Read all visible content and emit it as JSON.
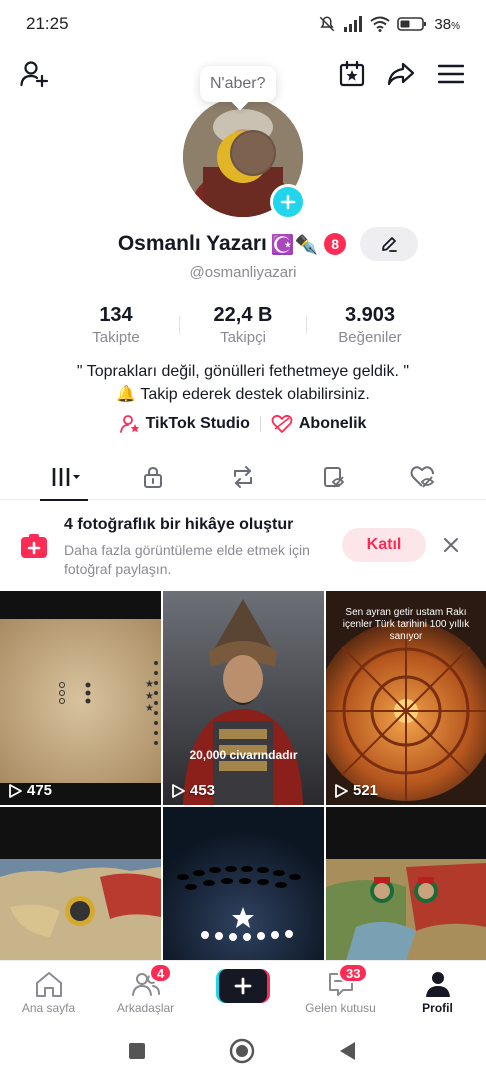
{
  "status_bar": {
    "time": "21:25",
    "battery": "38",
    "battery_unit": "%"
  },
  "bubble": {
    "text": "N'aber?"
  },
  "profile": {
    "name": "Osmanlı Yazarı",
    "name_emoji": "☪️✒️",
    "notification_count": "8",
    "username": "@osmanliyazari"
  },
  "stats": [
    {
      "value": "134",
      "label": "Takipte"
    },
    {
      "value": "22,4 B",
      "label": "Takipçi"
    },
    {
      "value": "3.903",
      "label": "Beğeniler"
    }
  ],
  "bio": {
    "line1": "\" Toprakları değil, gönülleri fethetmeye geldik. \"",
    "line2": "🔔 Takip ederek destek olabilirsiniz."
  },
  "links": {
    "studio": "TikTok Studio",
    "subscription": "Abonelik"
  },
  "story": {
    "title": "4 fotoğraflık bir hikâye oluştur",
    "subtitle": "Daha fazla görüntüleme elde etmek için fotoğraf paylaşın.",
    "join_label": "Katıl"
  },
  "videos": [
    {
      "views": "475"
    },
    {
      "views": "453",
      "caption": "20,000 civarındadır"
    },
    {
      "views": "521",
      "caption": "Sen ayran getir ustam Rakı içenler Türk tarihini 100 yıllık sanıyor"
    },
    {
      "views": ""
    },
    {
      "views": ""
    },
    {
      "views": ""
    }
  ],
  "bottom_nav": {
    "home": "Ana sayfa",
    "friends": "Arkadaşlar",
    "friends_badge": "4",
    "inbox": "Gelen kutusu",
    "inbox_badge": "33",
    "profile": "Profil"
  },
  "colors": {
    "accent": "#fe2c55",
    "cyan": "#20d5ec",
    "text": "#161823",
    "muted": "#8a8b91"
  }
}
